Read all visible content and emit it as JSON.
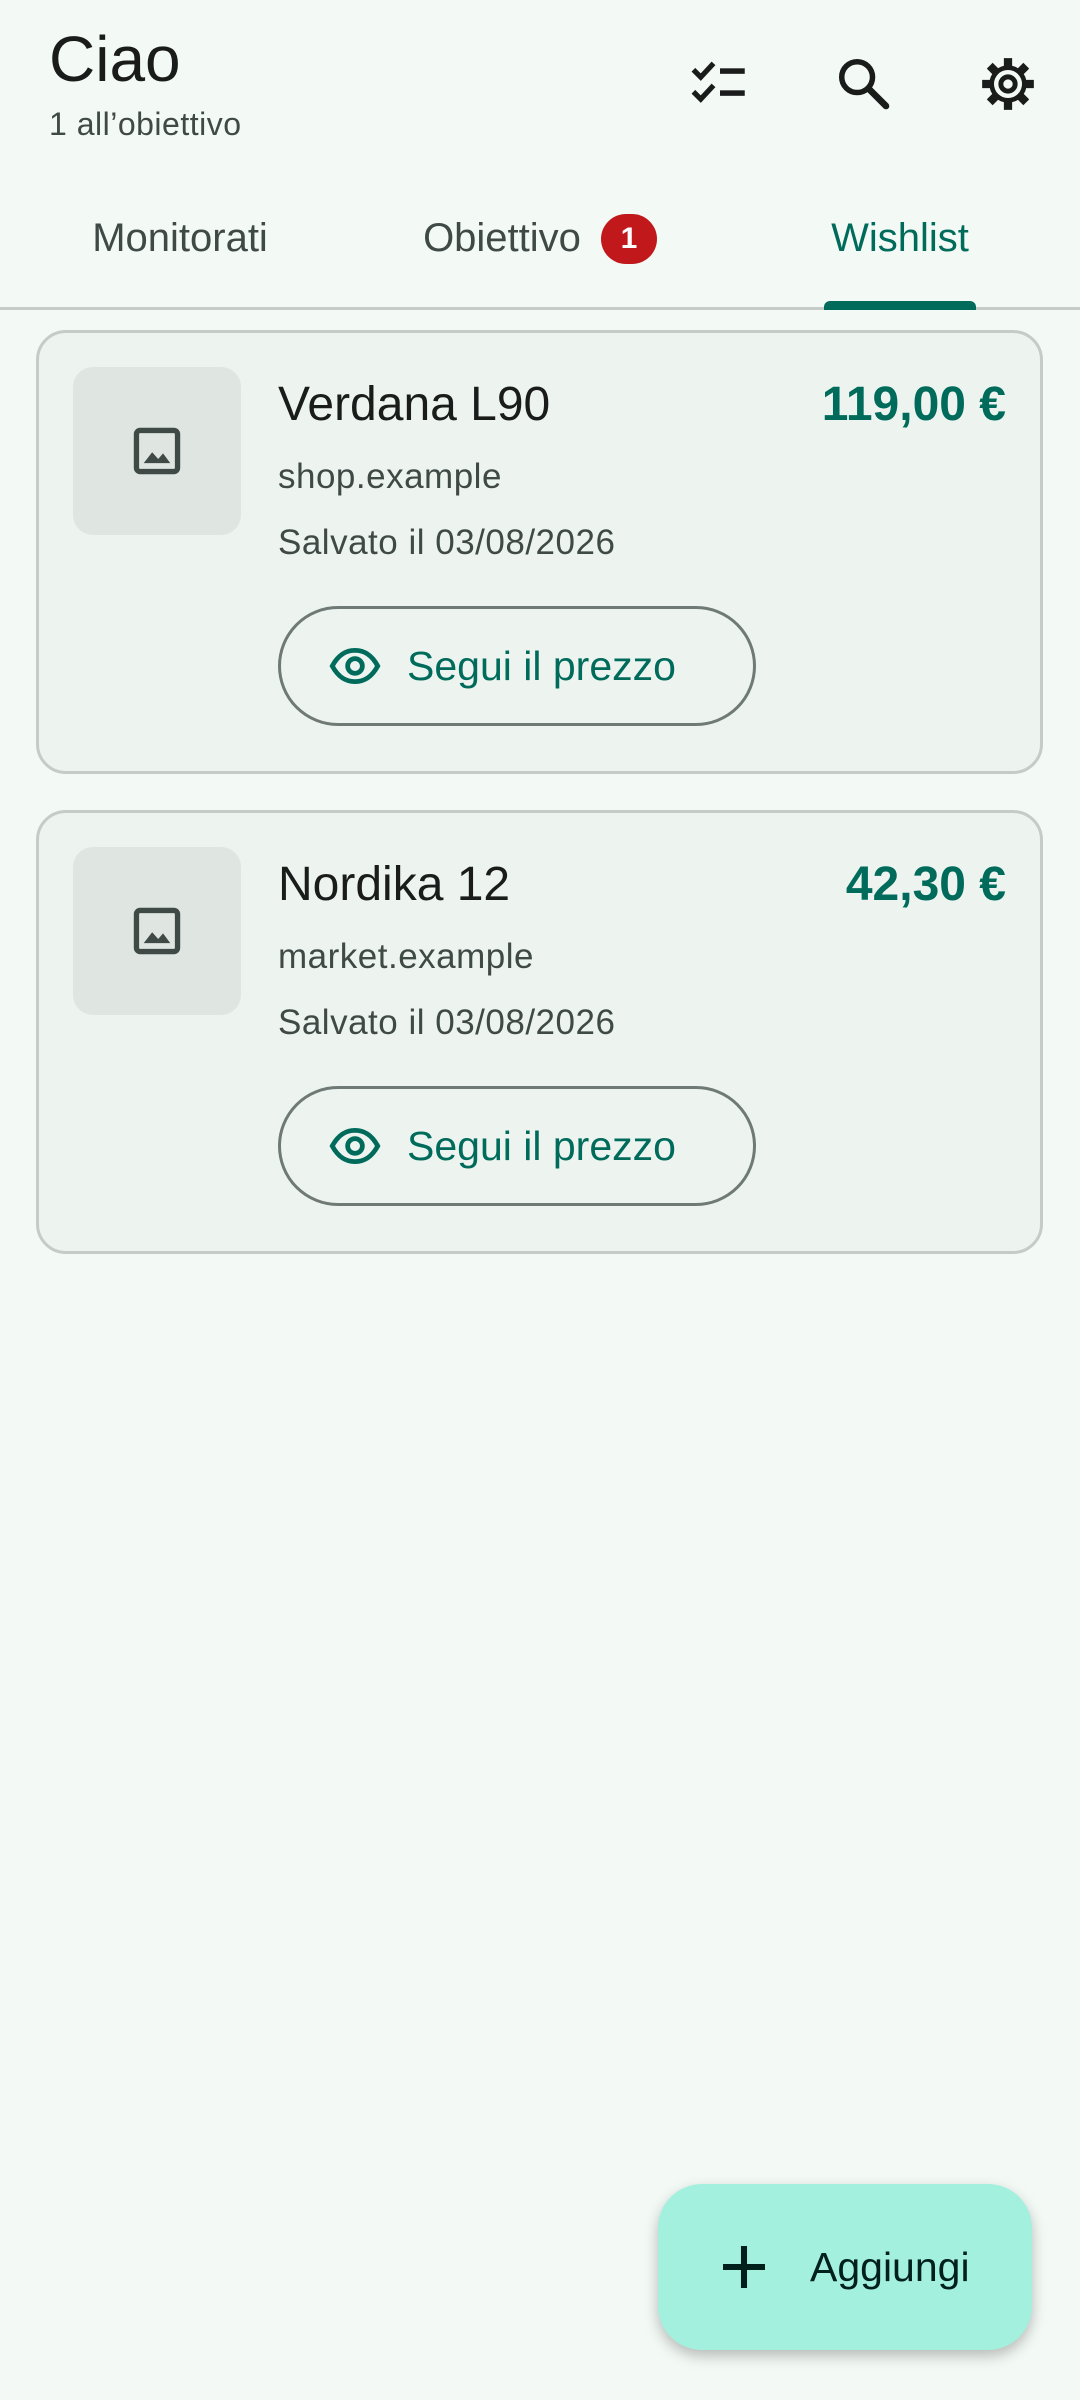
{
  "header": {
    "title": "Ciao",
    "subtitle": "1 all’obiettivo",
    "icons": [
      "checklist-icon",
      "search-icon",
      "settings-icon"
    ]
  },
  "tabs": [
    {
      "label": "Monitorati",
      "active": false
    },
    {
      "label": "Obiettivo",
      "badge": "1",
      "active": false
    },
    {
      "label": "Wishlist",
      "active": true
    }
  ],
  "items": [
    {
      "name": "Verdana L90",
      "price": "119,00 €",
      "shop": "shop.example",
      "saved": "Salvato il 03/08/2026",
      "action_label": "Segui il prezzo"
    },
    {
      "name": "Nordika 12",
      "price": "42,30 €",
      "shop": "market.example",
      "saved": "Salvato il 03/08/2026",
      "action_label": "Segui il prezzo"
    }
  ],
  "fab": {
    "label": "Aggiungi"
  },
  "colors": {
    "accent": "#006b5b",
    "badge": "#c0181b",
    "fab": "#a3f0df",
    "background": "#f3f9f5"
  }
}
